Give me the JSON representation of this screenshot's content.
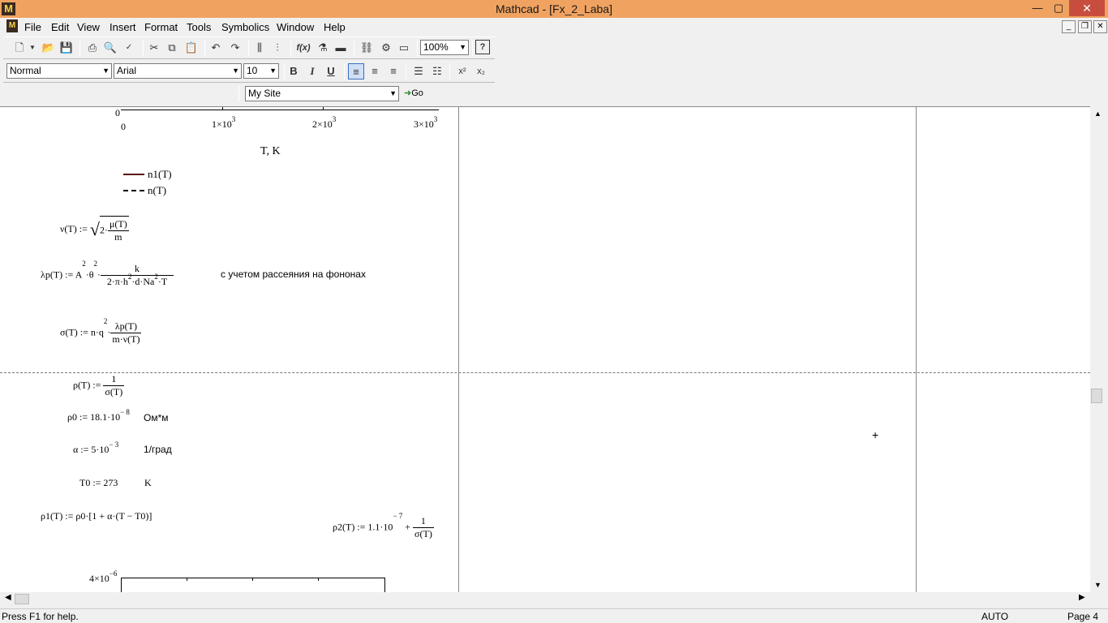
{
  "window": {
    "title": "Mathcad - [Fx_2_Laba]",
    "app_icon": "M",
    "minimize": "—",
    "maximize": "▢",
    "close": "✕"
  },
  "menu": [
    {
      "label": "File"
    },
    {
      "label": "Edit"
    },
    {
      "label": "View"
    },
    {
      "label": "Insert"
    },
    {
      "label": "Format"
    },
    {
      "label": "Tools"
    },
    {
      "label": "Symbolics"
    },
    {
      "label": "Window"
    },
    {
      "label": "Help"
    }
  ],
  "toolbar": {
    "zoom": "100%",
    "style": "Normal",
    "font": "Arial",
    "size": "10",
    "bold": "B",
    "italic": "I",
    "underline": "U",
    "site": "My Site",
    "go": "Go"
  },
  "worksheet": {
    "plot1": {
      "y_tick_bottom": "0",
      "x_ticks": [
        "0",
        "1×10",
        "2×10",
        "3×10"
      ],
      "x_tick_exp": "3",
      "x_label": "T, K",
      "legend": [
        "n1(T)",
        "n(T)"
      ]
    },
    "nu_def": {
      "lhs": "ν(T) :=",
      "two": "2·",
      "num": "μ(T)",
      "den": "m"
    },
    "lambda_def": {
      "lhs": "λp(T) := A",
      "mid": "·θ",
      "num": "k",
      "den_a": "2·π·h",
      "den_b": "·d·Na",
      "den_c": "·T",
      "note": "с учетом рассеяния на фононах"
    },
    "sigma_def": {
      "lhs": "σ(T) := n·q",
      "num": "λp(T)",
      "den": "m·ν(T)"
    },
    "rho_def": {
      "lhs": "ρ(T) :=",
      "num": "1",
      "den": "σ(T)"
    },
    "rho0": {
      "expr": "ρ0 := 18.1·10",
      "exp": "− 8",
      "unit": "Ом*м"
    },
    "alpha": {
      "expr": "α := 5·10",
      "exp": "− 3",
      "unit": "1/град"
    },
    "t0": {
      "expr": "T0 := 273",
      "unit": "K"
    },
    "rho1": {
      "expr": "ρ1(T) := ρ0·[1 + α·(T − T0)]"
    },
    "rho2": {
      "expr": "ρ2(T) := 1.1·10",
      "exp": "− 7",
      "plus": "+",
      "num": "1",
      "den": "σ(T)"
    },
    "plot2": {
      "y_tick_top": "4×10",
      "y_tick_exp": "−6"
    }
  },
  "status": {
    "help": "Press F1 for help.",
    "mode": "AUTO",
    "page": "Page 4"
  }
}
